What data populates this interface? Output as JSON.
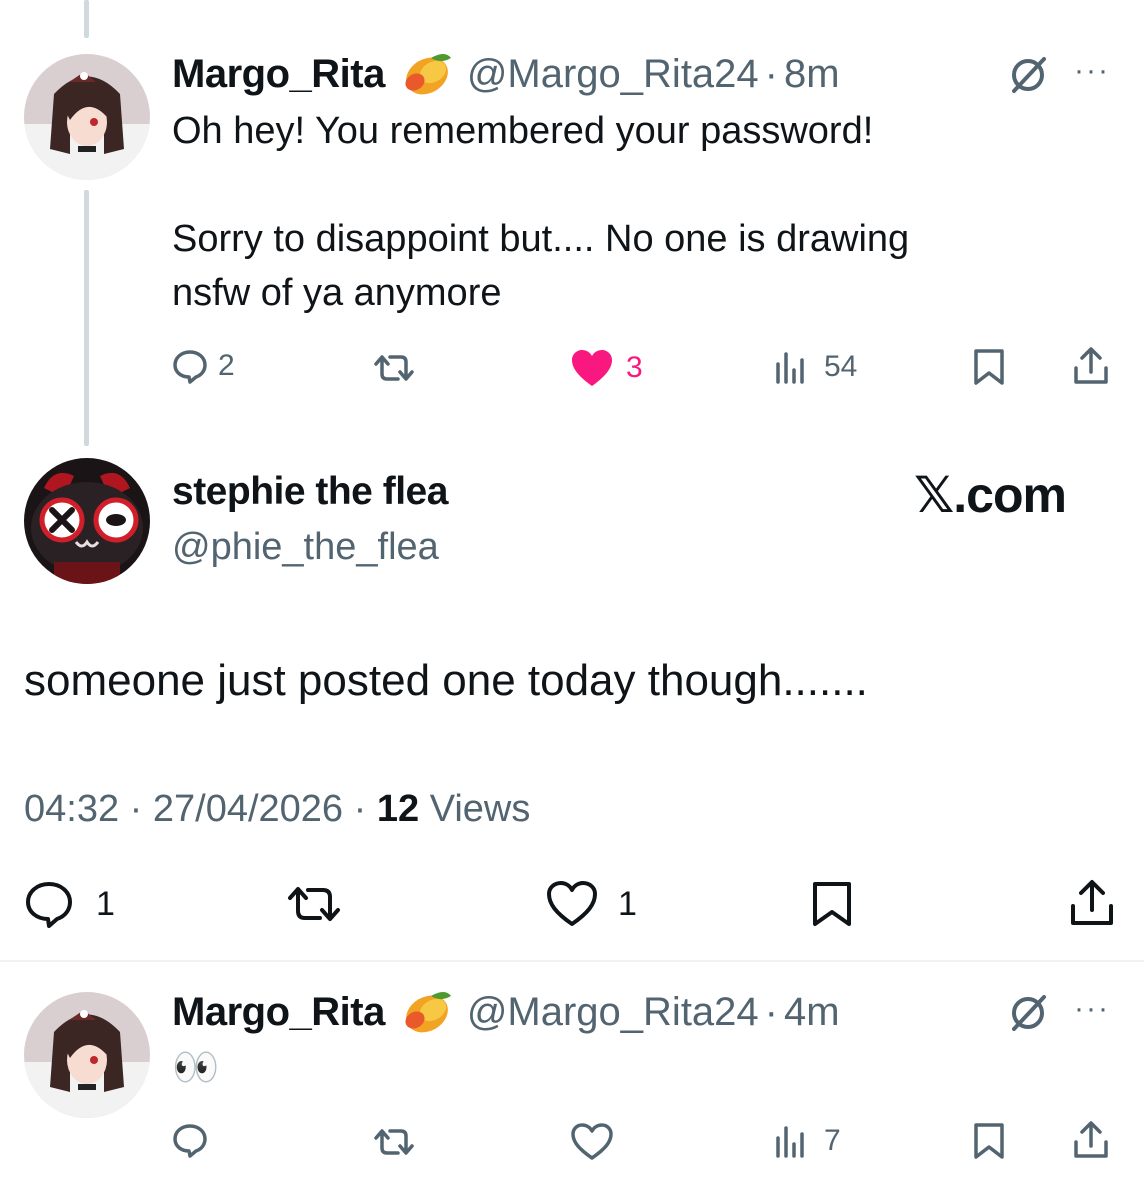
{
  "posts": [
    {
      "author": "Margo_Rita",
      "badge": "mango-emoji",
      "handle": "@Margo_Rita24",
      "separator": "·",
      "time": "8m",
      "text_line1": "Oh hey! You remembered your password!",
      "text_line2": "Sorry to disappoint but.... No one is drawing",
      "text_line3": "nsfw of ya anymore",
      "replies": "2",
      "likes": "3",
      "views": "54",
      "liked": true
    },
    {
      "author": "Margo_Rita",
      "badge": "mango-emoji",
      "handle": "@Margo_Rita24",
      "separator": "·",
      "time": "4m",
      "text_line1": "👀",
      "views": "7"
    }
  ],
  "main_post": {
    "author": "stephie the flea",
    "handle": "@phie_the_flea",
    "watermark": "𝕏.com",
    "text": "someone just posted one today though.......",
    "time": "04:32",
    "date": "27/04/2026",
    "dot": "·",
    "views_count": "12",
    "views_label": "Views",
    "replies": "1",
    "likes": "1"
  },
  "colors": {
    "like_pink": "#f91880",
    "muted": "#536471",
    "divider": "#eff3f4",
    "thread_line": "#cfd9de"
  },
  "more_label": "···"
}
